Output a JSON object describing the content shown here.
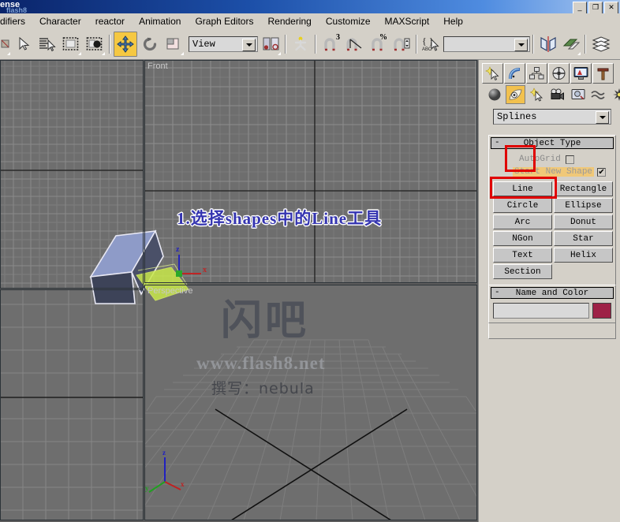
{
  "window": {
    "title_fragment": "ense",
    "watermark_small": "flash8",
    "buttons": {
      "minimize": "_",
      "restore": "❐",
      "close": "✕"
    }
  },
  "menu": {
    "items": [
      {
        "label": "difiers"
      },
      {
        "label": "Character"
      },
      {
        "label": "reactor"
      },
      {
        "label": "Animation"
      },
      {
        "label": "Graph Editors"
      },
      {
        "label": "Rendering"
      },
      {
        "label": "Customize"
      },
      {
        "label": "MAXScript"
      },
      {
        "label": "Help"
      }
    ]
  },
  "toolbar": {
    "reference_coord_value": "View",
    "named_selection_value": "",
    "snap_labels": {
      "snap3d": "3",
      "angle": "∠",
      "percent": "%"
    },
    "icons": [
      "undo-icon",
      "select-object-icon",
      "select-by-name-icon",
      "rectangular-selection-region-icon",
      "select-region-icon",
      "select-and-move-icon",
      "select-and-rotate-icon",
      "select-and-scale-icon",
      "reference-coordinate-system-dropdown",
      "use-pivot-point-center-icon",
      "select-and-manipulate-icon",
      "snaps-toggle-icon",
      "angle-snap-toggle-icon",
      "percent-snap-toggle-icon",
      "spinner-snap-toggle-icon",
      "named-selection-sets-icon",
      "named-selection-sets-dropdown",
      "mirror-icon",
      "align-icon",
      "layer-manager-icon"
    ]
  },
  "viewports": {
    "left_top": {
      "label": ""
    },
    "left_bottom": {
      "label": ""
    },
    "front": {
      "label": "Front",
      "active": true
    },
    "perspective": {
      "label": "Perspective",
      "active": false
    }
  },
  "annotation": {
    "step_text": "1.选择shapes中的Line工具"
  },
  "watermark": {
    "logo": "闪吧",
    "url": "www.flash8.net",
    "author": "撰写：nebula"
  },
  "axis_tripod": {
    "z": "z",
    "x": "x",
    "y": "y"
  },
  "command_panel": {
    "tabs": [
      {
        "name": "create",
        "icon": "create-star-arrow-icon",
        "selected": true
      },
      {
        "name": "modify",
        "icon": "modify-curve-icon",
        "selected": false
      },
      {
        "name": "hierarchy",
        "icon": "hierarchy-icon",
        "selected": false
      },
      {
        "name": "motion",
        "icon": "motion-wheel-icon",
        "selected": false
      },
      {
        "name": "display",
        "icon": "display-monitor-icon",
        "selected": false
      },
      {
        "name": "utilities",
        "icon": "utilities-hammer-icon",
        "selected": false
      }
    ],
    "create_subtabs": [
      {
        "name": "geometry",
        "icon": "sphere-icon",
        "highlighted": false
      },
      {
        "name": "shapes",
        "icon": "shapes-icon",
        "highlighted": true
      },
      {
        "name": "lights",
        "icon": "light-icon",
        "highlighted": false
      },
      {
        "name": "cameras",
        "icon": "camera-icon",
        "highlighted": false
      },
      {
        "name": "helpers",
        "icon": "helpers-icon",
        "highlighted": false
      },
      {
        "name": "space-warps",
        "icon": "space-warps-icon",
        "highlighted": false
      },
      {
        "name": "systems",
        "icon": "systems-icon",
        "highlighted": false
      }
    ],
    "category_value": "Splines",
    "object_type": {
      "header": "Object Type",
      "collapse_glyph": "-",
      "autogrid_label": "AutoGrid",
      "autogrid_checked": false,
      "start_new_shape_label": "Start New Shape",
      "start_new_shape_checked": true,
      "start_new_shape_check_glyph": "✔",
      "buttons": [
        {
          "label": "Line",
          "highlighted": true
        },
        {
          "label": "Rectangle",
          "highlighted": false
        },
        {
          "label": "Circle",
          "highlighted": false
        },
        {
          "label": "Ellipse",
          "highlighted": false
        },
        {
          "label": "Arc",
          "highlighted": false
        },
        {
          "label": "Donut",
          "highlighted": false
        },
        {
          "label": "NGon",
          "highlighted": false
        },
        {
          "label": "Star",
          "highlighted": false
        },
        {
          "label": "Text",
          "highlighted": false
        },
        {
          "label": "Helix",
          "highlighted": false
        },
        {
          "label": "Section",
          "highlighted": false
        }
      ]
    },
    "name_and_color": {
      "header": "Name and Color",
      "collapse_glyph": "-",
      "name_value": "",
      "color_hex": "#9e2146"
    }
  },
  "colors": {
    "highlight_yellow": "#f5c842",
    "active_viewport_border": "#e8e800",
    "annotation_blue": "#3434b0",
    "redbox": "#e00000",
    "viewport_gray": "#6e6e6e",
    "panel_gray": "#d4d0c8"
  }
}
